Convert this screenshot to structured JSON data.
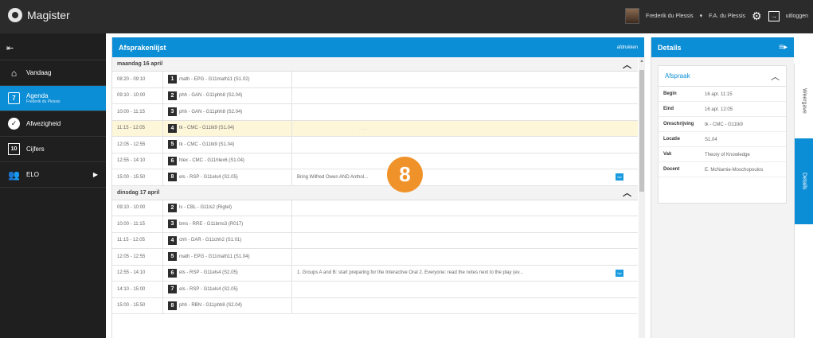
{
  "app": {
    "title": "Magister"
  },
  "topbar": {
    "user_name": "Frederik du Plessis",
    "user_select": "F.A. du Plessis",
    "logout": "uitloggen"
  },
  "sidebar": {
    "items": [
      {
        "label": "Vandaag"
      },
      {
        "label": "Agenda",
        "sub": "Frederik du Plessis"
      },
      {
        "label": "Afwezigheid"
      },
      {
        "label": "Cijfers"
      },
      {
        "label": "ELO"
      }
    ]
  },
  "main": {
    "title": "Afsprakenlijst",
    "print_label": "afdrukken",
    "days": [
      {
        "label": "maandag 16 april",
        "rows": [
          {
            "time": "08:20 - 09:10",
            "num": "1",
            "course": "math - EPG - G11math11 (S1.02)",
            "note": ""
          },
          {
            "time": "09:10 - 10:00",
            "num": "2",
            "course": "phh - GAN - G11phh8 (S2.04)",
            "note": ""
          },
          {
            "time": "10:00 - 11:15",
            "num": "3",
            "course": "phh - GAN - G11phh8 (S2.04)",
            "note": ""
          },
          {
            "time": "11:15 - 12:05",
            "num": "4",
            "course": "tk - CMC - G11tk9 (S1.04)",
            "note": ""
          },
          {
            "time": "12:05 - 12:55",
            "num": "5",
            "course": "tk - CMC - G11tk9 (S1.04)",
            "note": ""
          },
          {
            "time": "12:55 - 14:10",
            "num": "6",
            "course": "hlex - CMC - G11hlex6 (S1.04)",
            "note": ""
          },
          {
            "time": "15:00 - 15:50",
            "num": "8",
            "course": "els - RSP - G11els4 (S2.05)",
            "note": "Bring Wilfred Owen AND Anthol...",
            "hw": "hw"
          }
        ]
      },
      {
        "label": "dinsdag 17 april",
        "rows": [
          {
            "time": "09:10 - 10:00",
            "num": "2",
            "course": "ls - CBL - G11ls2 (Rigtel)",
            "note": ""
          },
          {
            "time": "10:00 - 11:15",
            "num": "3",
            "course": "bms - RRE - G11bms3 (R017)",
            "note": ""
          },
          {
            "time": "11:15 - 12:05",
            "num": "4",
            "course": "chh - DAR - G11chh2 (S1.01)",
            "note": ""
          },
          {
            "time": "12:05 - 12:55",
            "num": "5",
            "course": "math - EPG - G11math11 (S1.04)",
            "note": ""
          },
          {
            "time": "12:55 - 14:10",
            "num": "6",
            "course": "els - RSP - G11els4 (S2.05)",
            "note": "1. Groups A and B: start preparing for the Interactive Oral 2. Everyone: read the notes next to the play (ev...",
            "hw": "hw"
          },
          {
            "time": "14:10 - 15:00",
            "num": "7",
            "course": "els - RSP - G11els4 (S2.05)",
            "note": ""
          },
          {
            "time": "15:00 - 15:50",
            "num": "8",
            "course": "phh - RBN - G11phh8 (S2.04)",
            "note": ""
          }
        ]
      }
    ]
  },
  "badge": "8",
  "details": {
    "title": "Details",
    "card_title": "Afspraak",
    "fields": [
      {
        "label": "Begin",
        "value": "16 apr. 11:15"
      },
      {
        "label": "Eind",
        "value": "16 apr. 12:05"
      },
      {
        "label": "Omschrijving",
        "value": "tk - CMC - G11tk9"
      },
      {
        "label": "Locatie",
        "value": "S1.04"
      },
      {
        "label": "Vak",
        "value": "Theory of Knowledge"
      },
      {
        "label": "Docent",
        "value": "E. McNamie-Moschopoulos"
      }
    ]
  },
  "right_tabs": {
    "weergave": "Weergave",
    "details": "Details"
  },
  "colors": {
    "accent": "#0c8ed6",
    "topbar": "#2b2b2b",
    "sidebar": "#1f1f1f",
    "badge": "#f0922a",
    "selected_row": "#fdf6d9"
  }
}
